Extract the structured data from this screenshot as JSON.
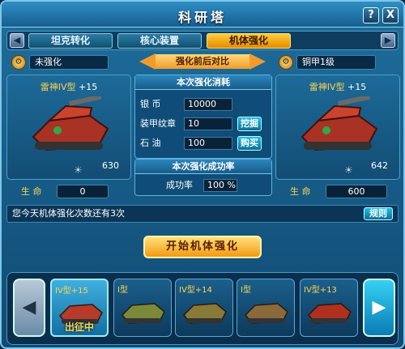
{
  "window": {
    "title": "科研塔",
    "help_label": "?",
    "close_label": "X"
  },
  "tabs": [
    {
      "label": "坦克转化"
    },
    {
      "label": "核心装置"
    },
    {
      "label": "机体强化"
    }
  ],
  "compare_label": "强化前后对比",
  "left": {
    "header": "未强化",
    "rank_icon": "rank-badge",
    "tank_name": "雷神IV型",
    "level": "+15",
    "power": "630",
    "life_label": "生 命",
    "life_value": "0"
  },
  "right": {
    "header": "铜甲1级",
    "rank_icon": "rank-badge",
    "tank_name": "雷神IV型",
    "level": "+15",
    "power": "642",
    "life_label": "生 命",
    "life_value": "600"
  },
  "cost": {
    "title": "本次强化消耗",
    "silver_label": "银 币",
    "silver_value": "10000",
    "armor_label": "装甲纹章",
    "armor_value": "10",
    "armor_button": "挖掘",
    "oil_label": "石 油",
    "oil_value": "100",
    "oil_button": "购买"
  },
  "success": {
    "title": "本次强化成功率",
    "rate_label": "成功率",
    "rate_value": "100 %"
  },
  "notice": {
    "text": "您今天机体强化次数还有3次",
    "rules_button": "规则"
  },
  "start_button": "开始机体强化",
  "roster": [
    {
      "label": "IV型+15",
      "status": "出征中",
      "color": "#b83a2a"
    },
    {
      "label": "I型",
      "status": "",
      "color": "#7a8a3a"
    },
    {
      "label": "IV型+14",
      "status": "",
      "color": "#8a7a3a"
    },
    {
      "label": "I型",
      "status": "",
      "color": "#8a6a3a"
    },
    {
      "label": "IV型+13",
      "status": "",
      "color": "#b03020"
    }
  ],
  "colors": {
    "accent": "#f39a10",
    "panel": "#124d74",
    "gold": "#ffd54a"
  }
}
